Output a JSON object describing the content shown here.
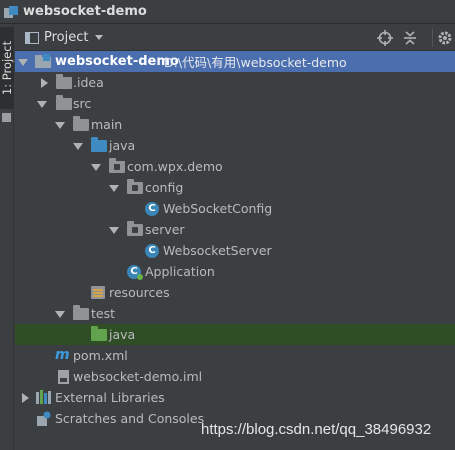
{
  "window": {
    "title": "websocket-demo"
  },
  "side_tab": {
    "label": "1: Project"
  },
  "toolbar": {
    "view_label": "Project"
  },
  "tree": {
    "root": {
      "name": "websocket-demo",
      "path": "D:\\代码\\有用\\websocket-demo"
    },
    "idea": ".idea",
    "src": "src",
    "main": "main",
    "java_main": "java",
    "package": "com.wpx.demo",
    "config": "config",
    "websocket_config": "WebSocketConfig",
    "server": "server",
    "websocket_server": "WebsocketServer",
    "application": "Application",
    "resources": "resources",
    "test": "test",
    "java_test": "java",
    "pom": "pom.xml",
    "iml": "websocket-demo.iml",
    "external_libraries": "External Libraries",
    "scratches": "Scratches and Consoles"
  },
  "icons": {
    "class_glyph": "C",
    "maven_glyph": "m"
  },
  "watermark": "https://blog.csdn.net/qq_38496932",
  "colors": {
    "background": "#3c3f41",
    "selection_root": "#4b6eaf",
    "selection_dark": "#0d293e",
    "test_highlight": "#304e26",
    "source_folder": "#3f8bc1",
    "test_folder": "#62a44d",
    "class_icon": "#3a86b7"
  }
}
